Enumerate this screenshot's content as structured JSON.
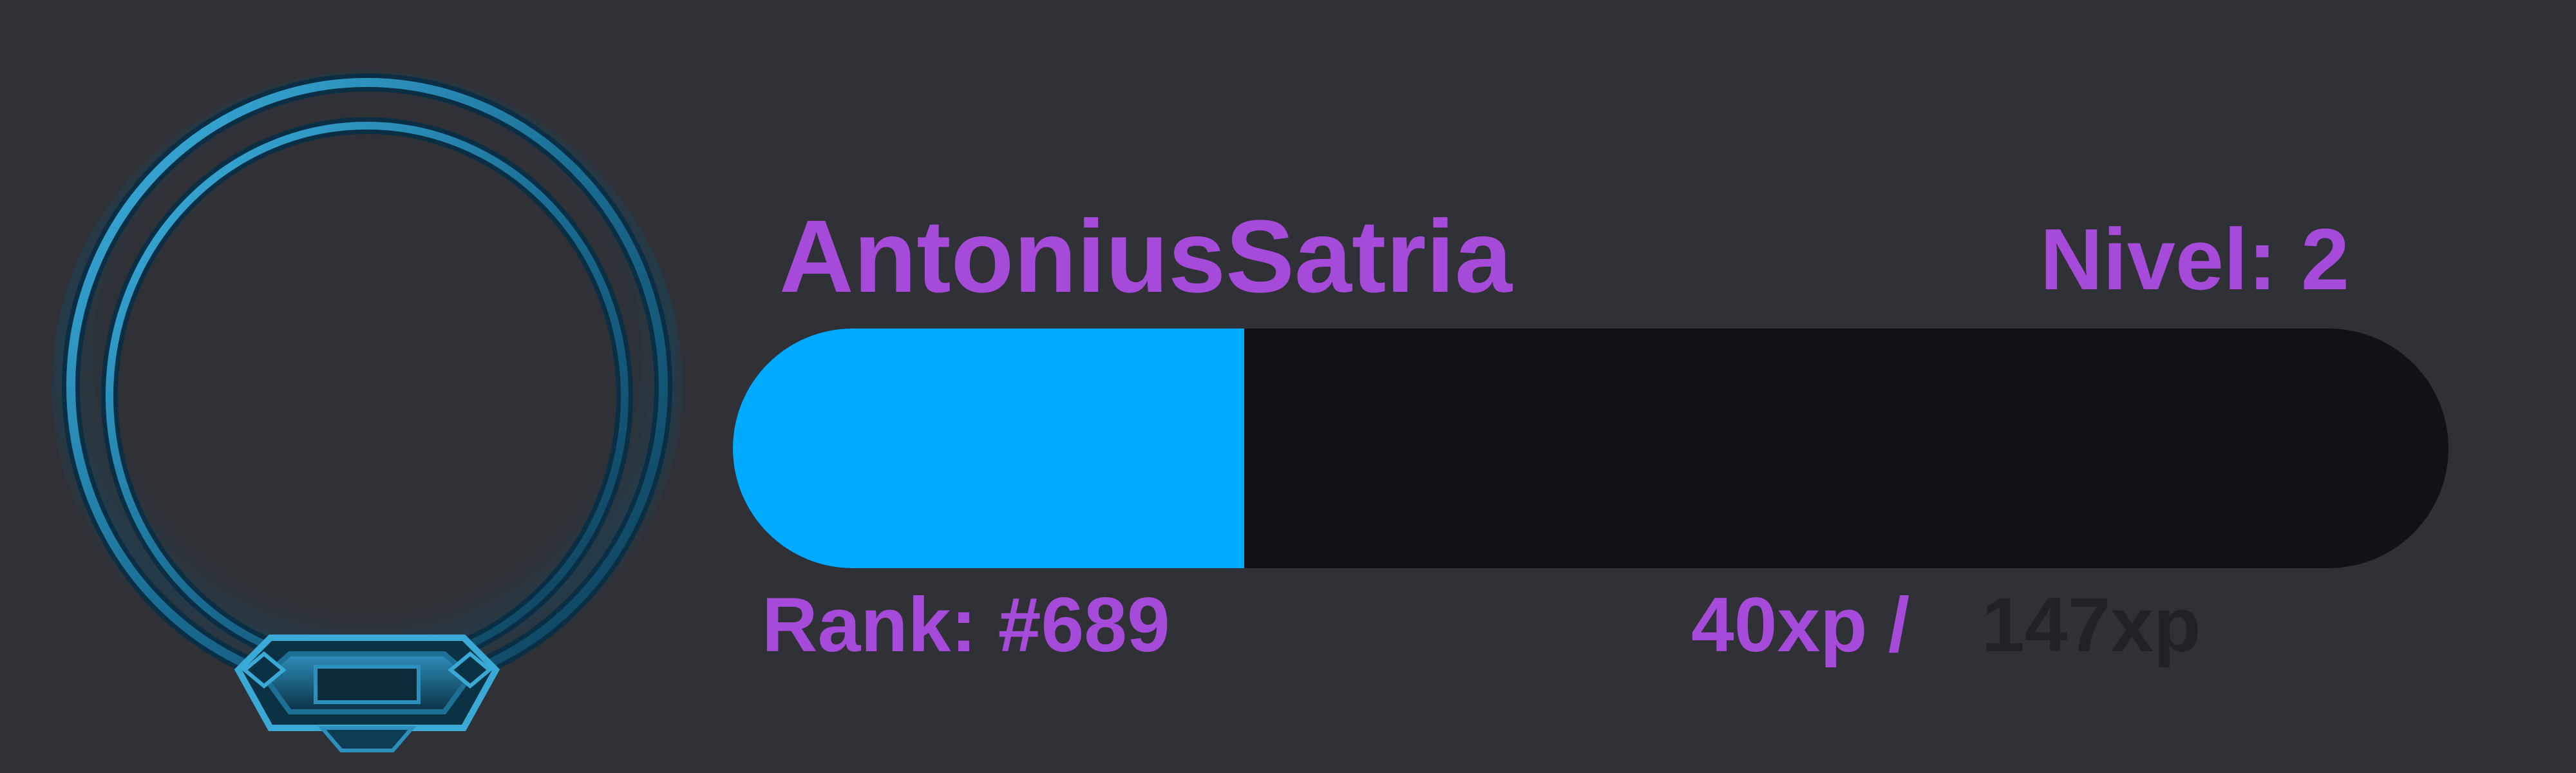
{
  "profile": {
    "username": "AntoniusSatria",
    "level_text": "Nivel: 2",
    "rank_text": "Rank: #689"
  },
  "xp": {
    "current_text": "40xp",
    "separator_text": "/",
    "total_text": "147xp",
    "current": 40,
    "total": 147,
    "bar_fill_fraction": 0.298
  },
  "colors": {
    "background": "#2f3136",
    "accent_text": "#a64bd9",
    "muted_text": "#202226",
    "bar_fill": "#00aaff",
    "bar_track": "#111215",
    "frame_ring": "#1e6f96"
  },
  "icons": {
    "avatar_frame": "ornate-ring-avatar-frame-icon"
  }
}
